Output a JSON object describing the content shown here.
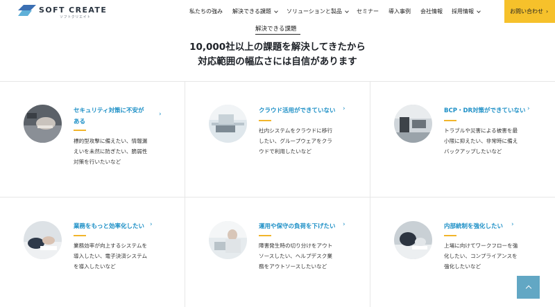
{
  "header": {
    "logo_text": "SOFT CREATE",
    "logo_sub": "ソフトクリエイト",
    "nav": [
      {
        "label": "私たちの強み",
        "dropdown": false
      },
      {
        "label": "解決できる課題",
        "dropdown": true
      },
      {
        "label": "ソリューションと製品",
        "dropdown": true
      },
      {
        "label": "セミナー",
        "dropdown": false
      },
      {
        "label": "導入事例",
        "dropdown": false
      },
      {
        "label": "会社情報",
        "dropdown": false
      },
      {
        "label": "採用情報",
        "dropdown": true
      }
    ],
    "contact_label": "お問い合わせ",
    "contact_arrow": "›"
  },
  "hero": {
    "label": "解決できる課題",
    "title_line1": "10,000社以上の課題を解決してきたから",
    "title_line2": "対応範囲の幅広さには自信があります"
  },
  "cards": [
    {
      "title_l1": "セキュリティ対策に不安が",
      "title_l2": "ある",
      "arrow": "›",
      "desc": [
        "標的型攻撃に備えたい、情報漏",
        "えいを未然に防ぎたい、脆弱性",
        "対策を行いたいなど"
      ],
      "photo": "security-photo"
    },
    {
      "title_l1": "クラウド活用ができていない",
      "title_l2": "",
      "arrow": "›",
      "desc": [
        "社内システムをクラウドに移行",
        "したい、グループウェアをクラ",
        "ウドで利用したいなど"
      ],
      "photo": "cloud-photo"
    },
    {
      "title_l1": "BCP・DR対策ができていない",
      "title_l2": "",
      "arrow": "›",
      "desc": [
        "トラブルや災害による被害を最",
        "小限に抑えたい、非常時に備え",
        "バックアップしたいなど"
      ],
      "photo": "bcp-photo"
    },
    {
      "title_l1": "業務をもっと効率化したい",
      "title_l2": "",
      "arrow": "›",
      "desc": [
        "業務効率が向上するシステムを",
        "導入したい、電子決済システム",
        "を導入したいなど"
      ],
      "photo": "efficiency-photo"
    },
    {
      "title_l1": "運用や保守の負荷を下げたい",
      "title_l2": "",
      "arrow": "›",
      "desc": [
        "障害発生時の切り分けをアウト",
        "ソースしたい、ヘルプデスク業",
        "務をアウトソースしたいなど"
      ],
      "photo": "maintenance-photo"
    },
    {
      "title_l1": "内部統制を強化したい",
      "title_l2": "",
      "arrow": "›",
      "desc": [
        "上場に向けてワークフローを強",
        "化したい、コンプライアンスを",
        "強化したいなど"
      ],
      "photo": "governance-photo"
    }
  ],
  "colors": {
    "accent_blue": "#1c8fc6",
    "accent_yellow": "#f6c12b",
    "underline_yellow": "#f2b52a",
    "to_top_bg": "#62a7c4"
  },
  "icons": {
    "back_to_top": "chevron-up-icon"
  }
}
